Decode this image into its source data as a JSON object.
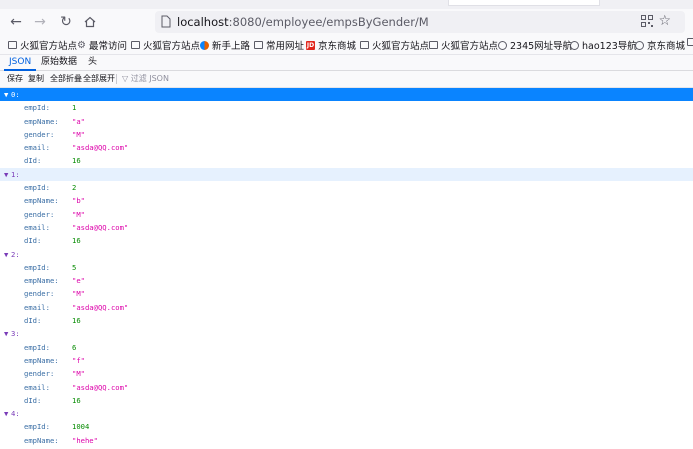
{
  "browser": {
    "url_host": "localhost",
    "url_rest": ":8080/employee/empsByGender/M",
    "bookmarks": [
      {
        "label": "火狐官方站点",
        "icon": "folder-icon"
      },
      {
        "label": "最常访问",
        "icon": "gear-icon"
      },
      {
        "label": "火狐官方站点",
        "icon": "folder-icon"
      },
      {
        "label": "新手上路",
        "icon": "firefox-icon"
      },
      {
        "label": "常用网址",
        "icon": "folder-icon"
      },
      {
        "label": "京东商城",
        "icon": "jd-icon"
      },
      {
        "label": "火狐官方站点",
        "icon": "folder-icon"
      },
      {
        "label": "火狐官方站点",
        "icon": "folder-icon"
      },
      {
        "label": "2345网址导航",
        "icon": "globe-icon"
      },
      {
        "label": "hao123导航",
        "icon": "globe-icon"
      },
      {
        "label": "京东商城",
        "icon": "globe-icon"
      }
    ]
  },
  "viewer": {
    "tabs": [
      "JSON",
      "原始数据",
      "头"
    ],
    "active_tab": "JSON",
    "toolbar": {
      "save": "保存",
      "copy": "复制",
      "collapse_all": "全部折叠",
      "expand_all": "全部展开",
      "filter_placeholder": "过滤 JSON"
    }
  },
  "colors": {
    "accent": "#0a84ff",
    "key": "#3a6ea5",
    "number": "#058b00",
    "string": "#dd00a9"
  },
  "records": [
    {
      "index": "0:",
      "fields": [
        [
          "empId:",
          "1"
        ],
        [
          "empName:",
          "\"a\""
        ],
        [
          "gender:",
          "\"M\""
        ],
        [
          "email:",
          "\"asda@QQ.com\""
        ],
        [
          "dId:",
          "16"
        ]
      ]
    },
    {
      "index": "1:",
      "fields": [
        [
          "empId:",
          "2"
        ],
        [
          "empName:",
          "\"b\""
        ],
        [
          "gender:",
          "\"M\""
        ],
        [
          "email:",
          "\"asda@QQ.com\""
        ],
        [
          "dId:",
          "16"
        ]
      ]
    },
    {
      "index": "2:",
      "fields": [
        [
          "empId:",
          "5"
        ],
        [
          "empName:",
          "\"e\""
        ],
        [
          "gender:",
          "\"M\""
        ],
        [
          "email:",
          "\"asda@QQ.com\""
        ],
        [
          "dId:",
          "16"
        ]
      ]
    },
    {
      "index": "3:",
      "fields": [
        [
          "empId:",
          "6"
        ],
        [
          "empName:",
          "\"f\""
        ],
        [
          "gender:",
          "\"M\""
        ],
        [
          "email:",
          "\"asda@QQ.com\""
        ],
        [
          "dId:",
          "16"
        ]
      ]
    },
    {
      "index": "4:",
      "fields": [
        [
          "empId:",
          "1004"
        ],
        [
          "empName:",
          "\"hehe\""
        ]
      ]
    }
  ]
}
